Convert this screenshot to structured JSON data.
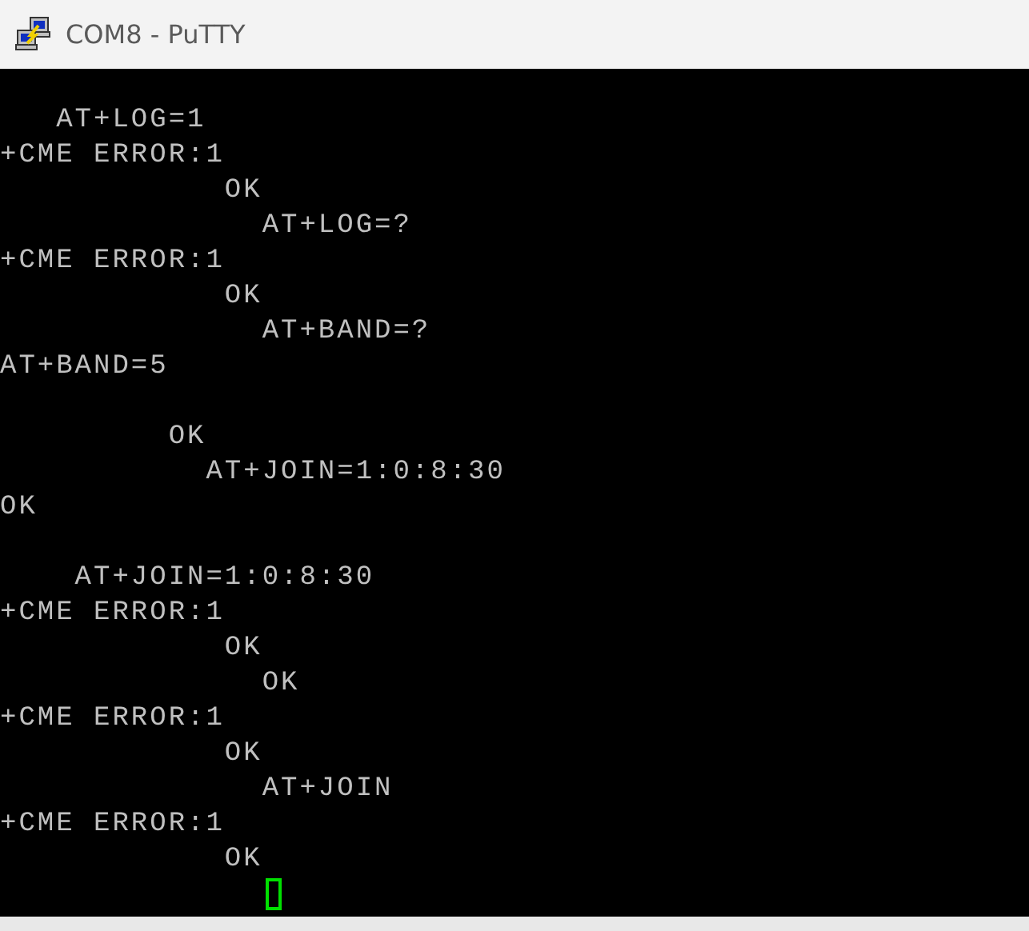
{
  "window": {
    "title": "COM8 - PuTTY"
  },
  "terminal": {
    "lines": [
      {
        "kind": "text",
        "text": "   AT+LOG=1"
      },
      {
        "kind": "text",
        "text": "+CME ERROR:1"
      },
      {
        "kind": "text",
        "text": "            OK"
      },
      {
        "kind": "text",
        "text": "              AT+LOG=?"
      },
      {
        "kind": "text",
        "text": "+CME ERROR:1"
      },
      {
        "kind": "text",
        "text": "            OK"
      },
      {
        "kind": "text",
        "text": "              AT+BAND=?"
      },
      {
        "kind": "text",
        "text": "AT+BAND=5"
      },
      {
        "kind": "blank"
      },
      {
        "kind": "text",
        "text": "         OK"
      },
      {
        "kind": "text",
        "text": "           AT+JOIN=1:0:8:30"
      },
      {
        "kind": "text",
        "text": "OK"
      },
      {
        "kind": "blank"
      },
      {
        "kind": "text",
        "text": "    AT+JOIN=1:0:8:30"
      },
      {
        "kind": "text",
        "text": "+CME ERROR:1"
      },
      {
        "kind": "text",
        "text": "            OK"
      },
      {
        "kind": "text",
        "text": "              OK"
      },
      {
        "kind": "text",
        "text": "+CME ERROR:1"
      },
      {
        "kind": "text",
        "text": "            OK"
      },
      {
        "kind": "text",
        "text": "              AT+JOIN"
      },
      {
        "kind": "text",
        "text": "+CME ERROR:1"
      },
      {
        "kind": "text",
        "text": "            OK"
      }
    ],
    "cursor": {
      "visible": true
    }
  }
}
